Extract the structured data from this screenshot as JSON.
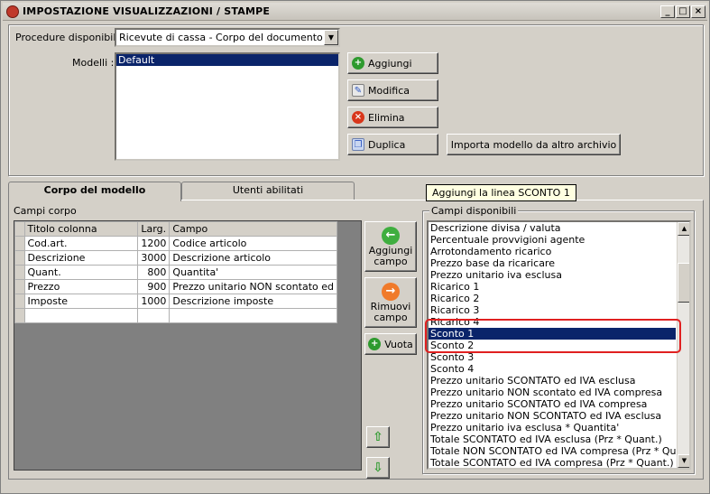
{
  "window": {
    "title": "IMPOSTAZIONE VISUALIZZAZIONI / STAMPE"
  },
  "top": {
    "procedure_label": "Procedure disponibili :",
    "procedure_value": "Ricevute di cassa - Corpo del documento",
    "modelli_label": "Modelli :",
    "modelli": [
      "Default"
    ],
    "buttons": {
      "add": "Aggiungi",
      "edit": "Modifica",
      "delete": "Elimina",
      "duplicate": "Duplica",
      "import": "Importa modello da altro archivio"
    }
  },
  "tabs": [
    "Corpo del modello",
    "Utenti abilitati"
  ],
  "campi_corpo_label": "Campi corpo",
  "grid": {
    "headers": [
      "Titolo colonna",
      "Larg.",
      "Campo"
    ],
    "rows": [
      [
        "Cod.art.",
        "1200",
        "Codice articolo"
      ],
      [
        "Descrizione",
        "3000",
        "Descrizione articolo"
      ],
      [
        "Quant.",
        "800",
        "Quantita'"
      ],
      [
        "Prezzo",
        "900",
        "Prezzo unitario NON scontato ed"
      ],
      [
        "Imposte",
        "1000",
        "Descrizione imposte"
      ]
    ]
  },
  "middle_buttons": {
    "add_field": "Aggiungi campo",
    "remove_field": "Rimuovi campo",
    "empty": "Vuota"
  },
  "available": {
    "label": "Campi disponibili",
    "tooltip": "Aggiungi la linea SCONTO 1",
    "items": [
      "Descrizione divisa / valuta",
      "Percentuale provvigioni agente",
      "Arrotondamento ricarico",
      "Prezzo base da ricaricare",
      "Prezzo unitario iva esclusa",
      "Ricarico 1",
      "Ricarico 2",
      "Ricarico 3",
      "Ricarico 4",
      "Sconto 1",
      "Sconto 2",
      "Sconto 3",
      "Sconto 4",
      "Prezzo unitario SCONTATO ed IVA esclusa",
      "Prezzo unitario NON scontato ed IVA compresa",
      "Prezzo unitario SCONTATO ed IVA compresa",
      "Prezzo unitario NON SCONTATO ed IVA esclusa",
      "Prezzo unitario iva esclusa * Quantita'",
      "Totale SCONTATO ed IVA esclusa (Prz * Quant.)",
      "Totale NON SCONTATO ed IVA compresa (Prz * Quant.)",
      "Totale SCONTATO ed IVA compresa (Prz * Quant.)"
    ],
    "selected": "Sconto 1"
  },
  "colors": {
    "selection": "#0a246a",
    "highlight": "#e02020"
  }
}
